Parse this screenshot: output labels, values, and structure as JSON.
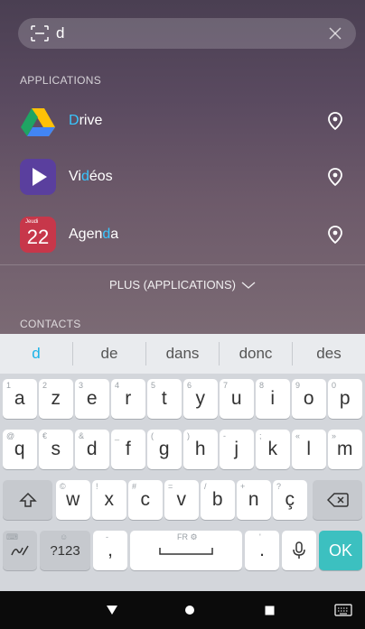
{
  "search": {
    "query": "d"
  },
  "sections": {
    "applications": "APPLICATIONS",
    "contacts": "CONTACTS"
  },
  "apps": [
    {
      "prefix": "",
      "highlight": "D",
      "suffix": "rive",
      "icon": "google-drive-icon"
    },
    {
      "prefix": "Vi",
      "highlight": "d",
      "suffix": "éos",
      "icon": "play-videos-icon"
    },
    {
      "prefix": "Agen",
      "highlight": "d",
      "suffix": "a",
      "icon": "calendar-icon",
      "icon_day": "Jeudi",
      "icon_date": "22"
    }
  ],
  "more_label": "PLUS (APPLICATIONS)",
  "suggestions": [
    "d",
    "de",
    "dans",
    "donc",
    "des"
  ],
  "keyboard": {
    "row1": [
      {
        "k": "a",
        "h": "1"
      },
      {
        "k": "z",
        "h": "2"
      },
      {
        "k": "e",
        "h": "3"
      },
      {
        "k": "r",
        "h": "4"
      },
      {
        "k": "t",
        "h": "5"
      },
      {
        "k": "y",
        "h": "6"
      },
      {
        "k": "u",
        "h": "7"
      },
      {
        "k": "i",
        "h": "8"
      },
      {
        "k": "o",
        "h": "9"
      },
      {
        "k": "p",
        "h": "0"
      }
    ],
    "row2": [
      {
        "k": "q",
        "h": "@"
      },
      {
        "k": "s",
        "h": "€"
      },
      {
        "k": "d",
        "h": "&"
      },
      {
        "k": "f",
        "h": "_"
      },
      {
        "k": "g",
        "h": "("
      },
      {
        "k": "h",
        "h": ")"
      },
      {
        "k": "j",
        "h": "-"
      },
      {
        "k": "k",
        "h": ";"
      },
      {
        "k": "l",
        "h": "«"
      },
      {
        "k": "m",
        "h": "»"
      }
    ],
    "row3": [
      {
        "k": "w",
        "h": "©"
      },
      {
        "k": "x",
        "h": "!"
      },
      {
        "k": "c",
        "h": "#"
      },
      {
        "k": "v",
        "h": "="
      },
      {
        "k": "b",
        "h": "/"
      },
      {
        "k": "n",
        "h": "+"
      },
      {
        "k": "ç",
        "h": "?"
      }
    ],
    "symbols_label": "?123",
    "comma_label": ",",
    "space_label": "FR ⚙",
    "period_label": ".",
    "ok_label": "OK",
    "comma_hint": "-",
    "period_hint": "'",
    "symbols_hint": "☺"
  },
  "colors": {
    "accent": "#1ab3e8",
    "ok_key": "#3cc0c0",
    "highlight": "#38c6ff"
  }
}
